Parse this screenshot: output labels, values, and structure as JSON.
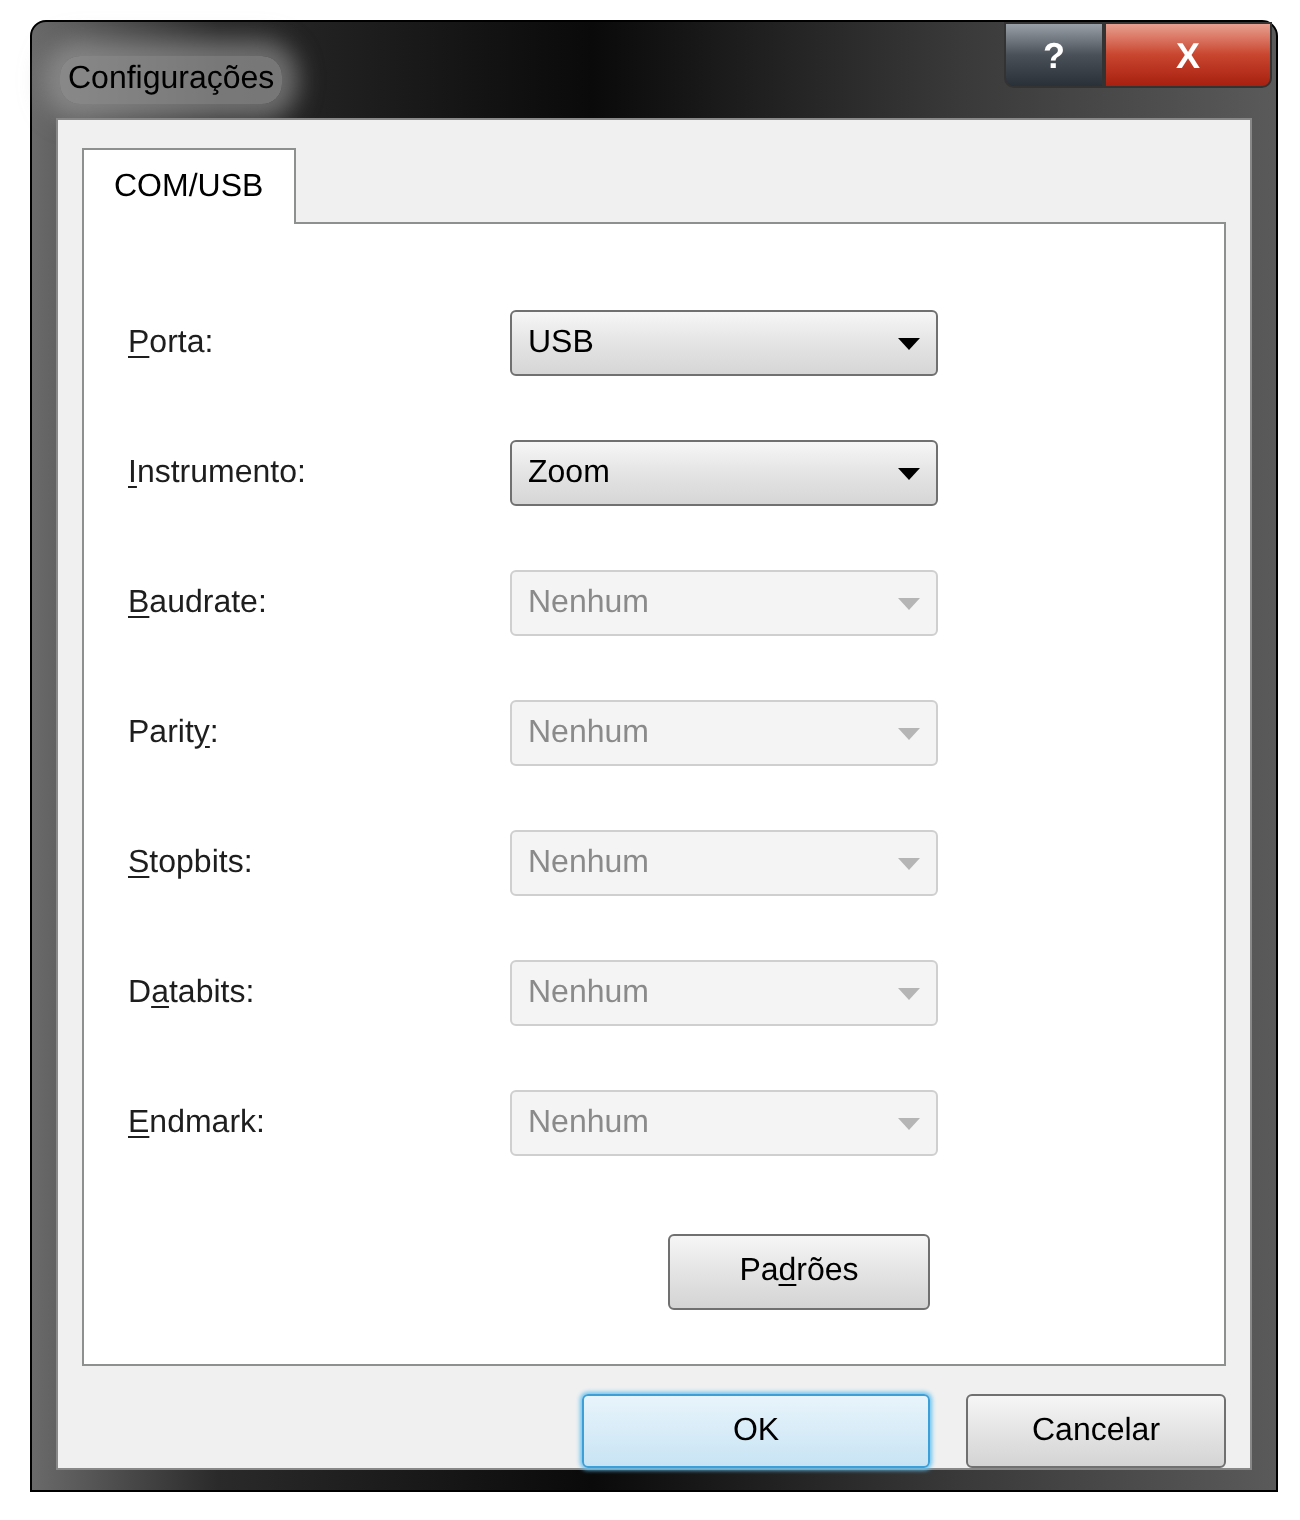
{
  "window": {
    "title": "Configurações",
    "title_buttons": [
      {
        "kind": "help",
        "label": "?"
      },
      {
        "kind": "close",
        "label": "X"
      }
    ]
  },
  "tabs": [
    {
      "label": "COM/USB",
      "selected": true
    }
  ],
  "fields": [
    {
      "access_key": "P",
      "label_after": "orta:",
      "value": "USB",
      "disabled": false
    },
    {
      "access_key": "I",
      "label_after": "nstrumento:",
      "value": "Zoom",
      "disabled": false
    },
    {
      "access_key": "B",
      "label_after": "audrate:",
      "value": "Nenhum",
      "disabled": true
    },
    {
      "label_before": "Parit",
      "access_key": "y",
      "label_after": ":",
      "value": "Nenhum",
      "disabled": true
    },
    {
      "access_key": "S",
      "label_after": "topbits:",
      "value": "Nenhum",
      "disabled": true
    },
    {
      "label_before": "D",
      "access_key": "a",
      "label_after": "tabits:",
      "value": "Nenhum",
      "disabled": true
    },
    {
      "access_key": "E",
      "label_after": "ndmark:",
      "value": "Nenhum",
      "disabled": true
    }
  ],
  "defaults_button": {
    "label_before": "Pa",
    "access_key": "d",
    "label_after": "rões"
  },
  "buttons": [
    {
      "label": "OK",
      "default": true
    },
    {
      "label": "Cancelar",
      "default": false
    }
  ]
}
